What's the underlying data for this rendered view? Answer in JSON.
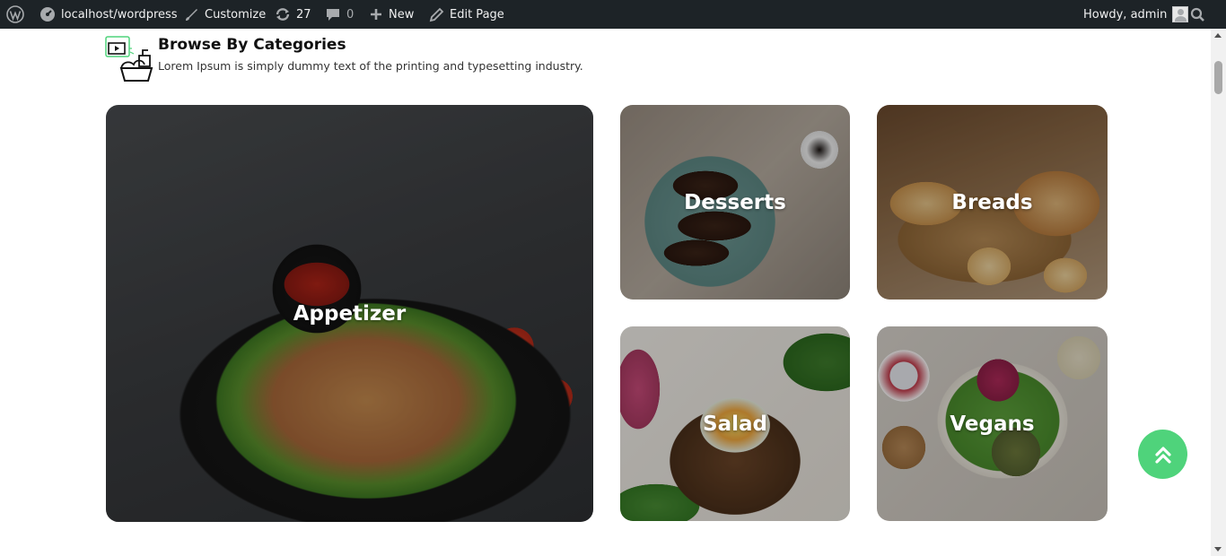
{
  "admin_bar": {
    "site_name": "localhost/wordpress",
    "customize": "Customize",
    "updates_count": "27",
    "comments_count": "0",
    "new_label": "New",
    "edit_page": "Edit Page",
    "howdy": "Howdy, admin",
    "icons": [
      "wordpress-logo-icon",
      "dashboard-icon",
      "brush-icon",
      "refresh-icon",
      "comment-icon",
      "plus-icon",
      "pencil-icon",
      "avatar",
      "search-icon"
    ]
  },
  "section": {
    "title": "Browse By Categories",
    "subtitle": "Lorem Ipsum is simply dummy text of the printing and typesetting industry.",
    "icon": "food-delivery-icon"
  },
  "categories": [
    {
      "label": "Appetizer"
    },
    {
      "label": "Desserts"
    },
    {
      "label": "Breads"
    },
    {
      "label": "Salad"
    },
    {
      "label": "Vegans"
    }
  ],
  "back_to_top": {
    "icon": "double-chevron-up-icon",
    "color": "#4fd37b"
  },
  "colors": {
    "admin_bar": "#1d2327",
    "accent": "#4fd37b"
  }
}
